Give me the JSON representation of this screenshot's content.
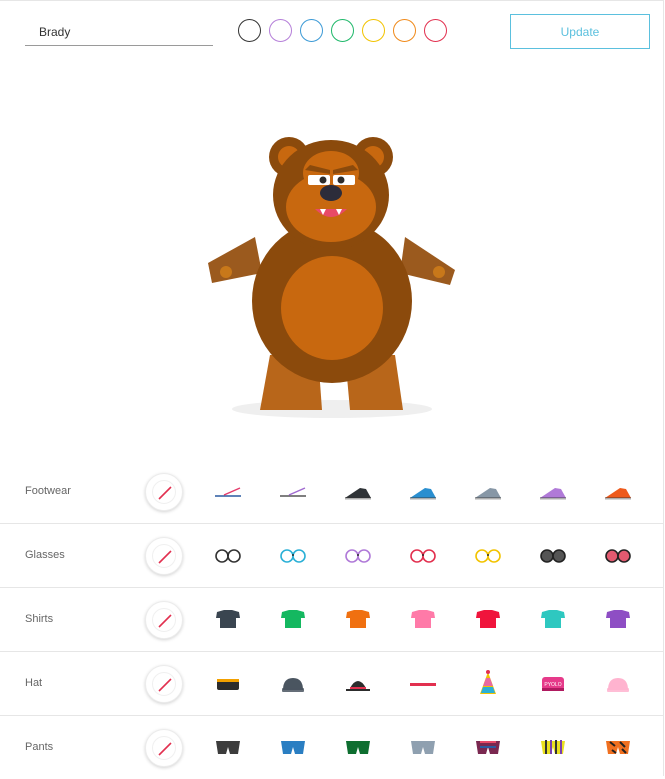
{
  "header": {
    "name_value": "Brady",
    "update_label": "Update",
    "colors": [
      "#333333",
      "#b57fd9",
      "#3c9ad6",
      "#1fb86a",
      "#f2c300",
      "#f08a1a",
      "#e2304f"
    ]
  },
  "categories": [
    {
      "label": "Footwear",
      "items": [
        "flip-flop-pink",
        "flip-flop-purple",
        "shoe-dark",
        "shoe-blue",
        "shoe-gray",
        "shoe-lilac",
        "shoe-orange"
      ]
    },
    {
      "label": "Glasses",
      "items": [
        "glasses-black",
        "glasses-cyan",
        "glasses-purple",
        "glasses-red",
        "glasses-yellow",
        "sunglasses-gray",
        "sunglasses-pink"
      ]
    },
    {
      "label": "Shirts",
      "items": [
        "shirt-slate",
        "shirt-green",
        "shirt-orange",
        "shirt-pink",
        "shirt-red",
        "shirt-teal",
        "shirt-purple"
      ]
    },
    {
      "label": "Hat",
      "items": [
        "cap-dark",
        "beanie-gray",
        "bowler-hat",
        "headband-red",
        "party-hat",
        "pyolo-cap",
        "beanie-pink"
      ]
    },
    {
      "label": "Pants",
      "items": [
        "shorts-dark",
        "shorts-blue",
        "shorts-green",
        "shorts-light",
        "shorts-stars",
        "shorts-stripes",
        "shorts-tiger"
      ]
    }
  ]
}
